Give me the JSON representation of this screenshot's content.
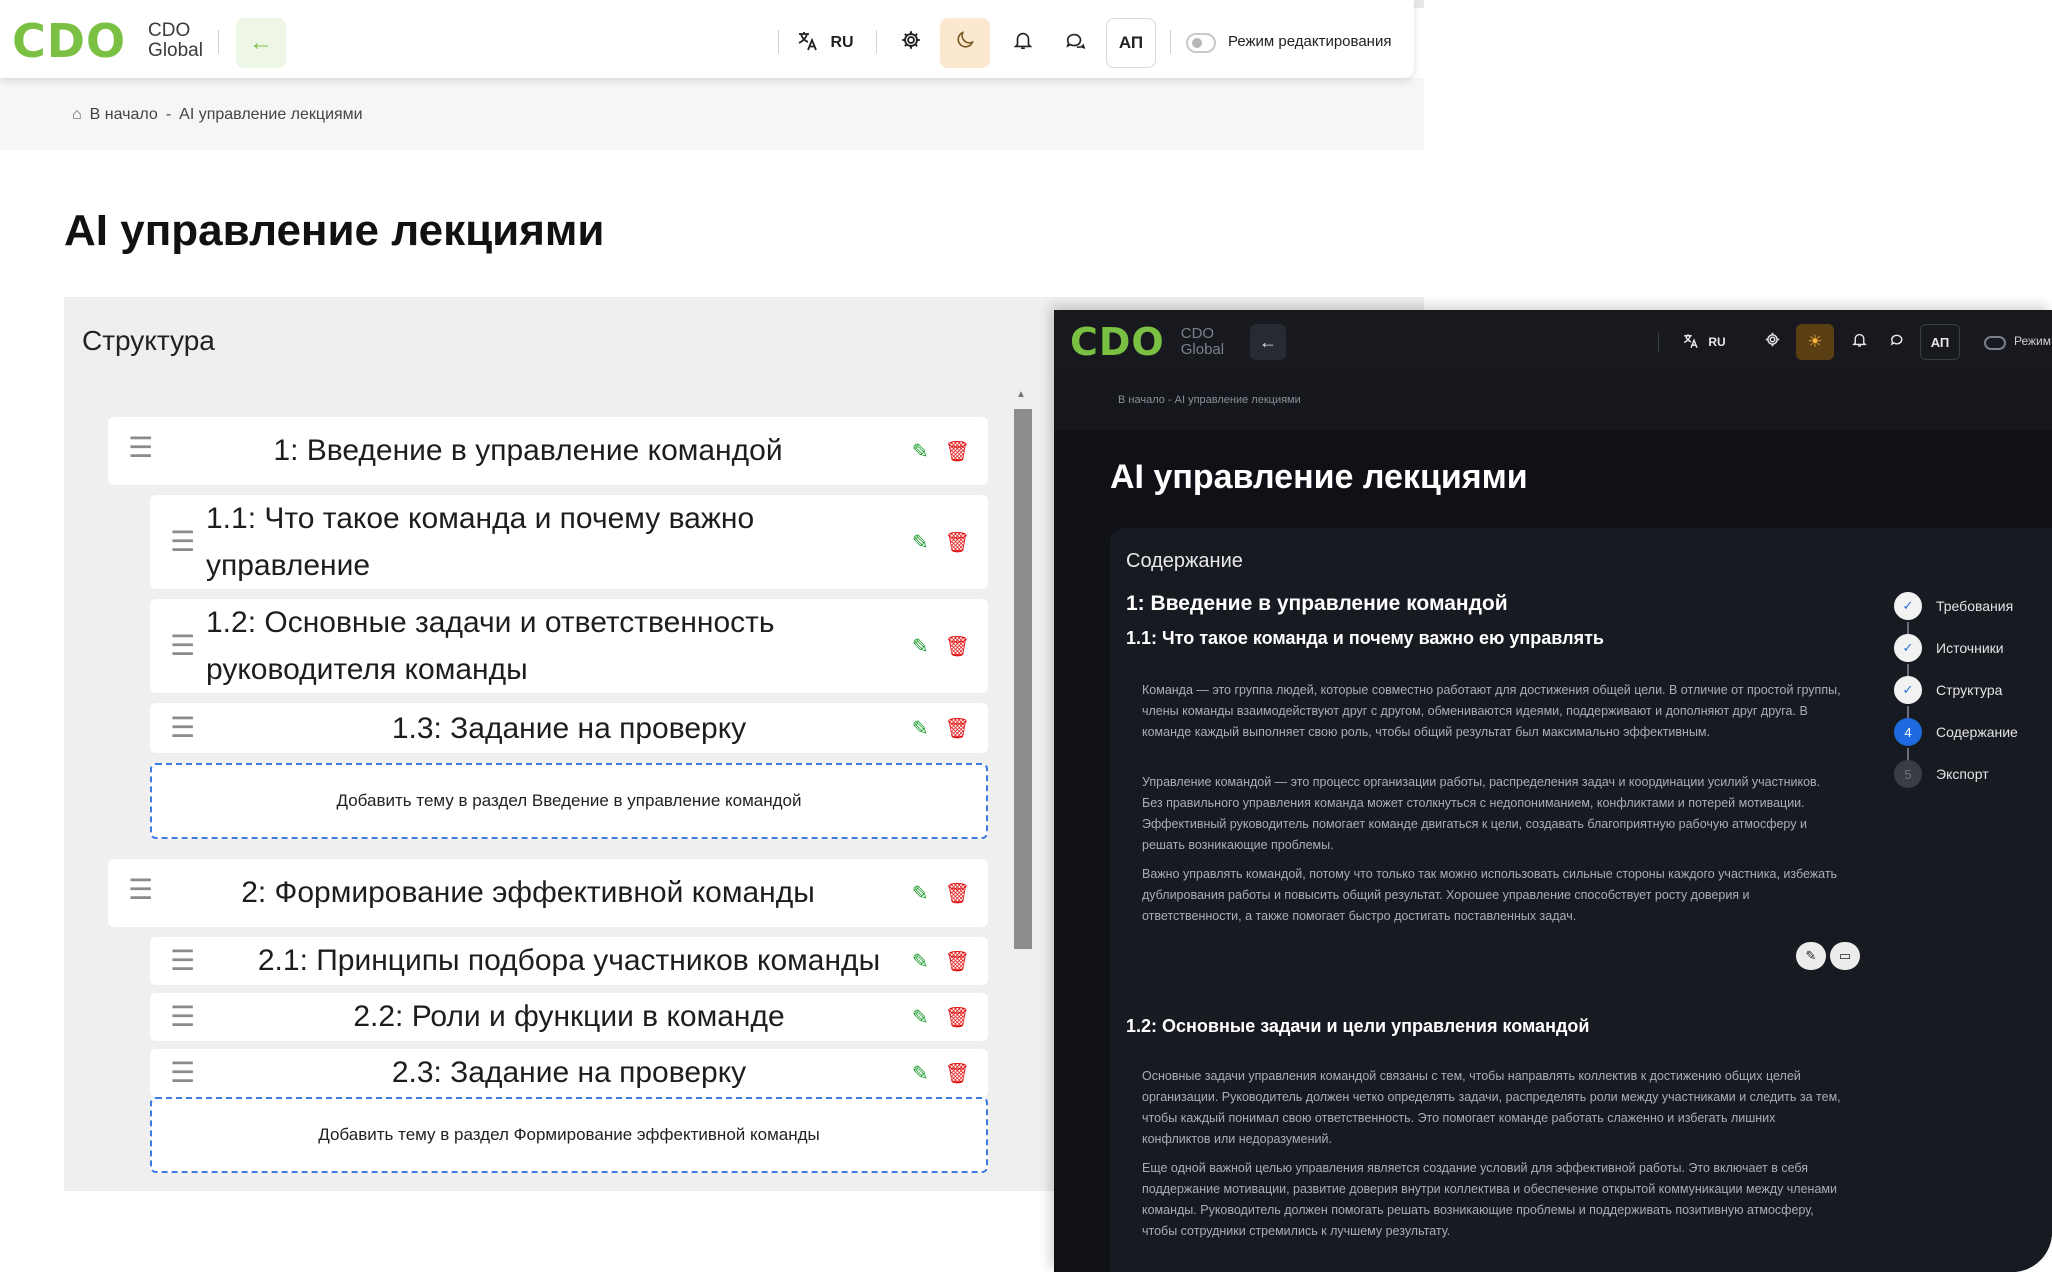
{
  "brand": {
    "mark": "CDO",
    "sub_line1": "CDO",
    "sub_line2": "Global",
    "accent": "#7ac143"
  },
  "header": {
    "back_icon": "arrow-left-icon",
    "language": "RU",
    "avatar_initials": "АП",
    "edit_mode_label": "Режим редактирования",
    "icons": [
      "translate-icon",
      "gear-icon",
      "moon-icon",
      "bell-icon",
      "chat-icon"
    ]
  },
  "breadcrumb": {
    "home": "В начало",
    "separator": "-",
    "current": "AI управление лекциями"
  },
  "page": {
    "title": "AI управление лекциями"
  },
  "structure": {
    "title": "Структура",
    "sections": [
      {
        "label": "1: Введение в управление командой",
        "topics": [
          {
            "label_line1": "1.1: Что такое команда и почему важно",
            "label_line2": "управление"
          },
          {
            "label_line1": "1.2: Основные задачи и ответственность",
            "label_line2": "руководителя команды"
          },
          {
            "label_line1": "1.3: Задание на проверку",
            "label_line2": ""
          }
        ],
        "add_label": "Добавить тему в раздел Введение в управление командой"
      },
      {
        "label": "2: Формирование эффективной команды",
        "topics": [
          {
            "label_line1": "2.1: Принципы подбора участников команды",
            "label_line2": ""
          },
          {
            "label_line1": "2.2: Роли и функции в команде",
            "label_line2": ""
          },
          {
            "label_line1": "2.3: Задание на проверку",
            "label_line2": ""
          }
        ],
        "add_label": "Добавить тему в раздел Формирование эффективной команды"
      }
    ]
  },
  "dark_view": {
    "breadcrumb": "В начало  -  AI управление лекциями",
    "title": "AI управление лекциями",
    "panel_title": "Содержание",
    "heading_1": "1: Введение в управление командой",
    "heading_1_1": "1.1: Что такое команда и почему важно ею управлять",
    "paragraphs_1_1": [
      "Команда — это группа людей, которые совместно работают для достижения общей цели. В отличие от простой группы, члены команды взаимодействуют друг с другом, обмениваются идеями, поддерживают и дополняют друг друга. В команде каждый выполняет свою роль, чтобы общий результат был максимально эффективным.",
      "Управление командой — это процесс организации работы, распределения задач и координации усилий участников. Без правильного управления команда может столкнуться с недопониманием, конфликтами и потерей мотивации. Эффективный руководитель помогает команде двигаться к цели, создавать благоприятную рабочую атмосферу и решать возникающие проблемы.",
      "Важно управлять командой, потому что только так можно использовать сильные стороны каждого участника, избежать дублирования работы и повысить общий результат. Хорошее управление способствует росту доверия и ответственности, а также помогает быстро достигать поставленных задач."
    ],
    "heading_1_2": "1.2: Основные задачи и цели управления командой",
    "paragraphs_1_2": [
      "Основные задачи управления командой связаны с тем, чтобы направлять коллектив к достижению общих целей организации. Руководитель должен четко определять задачи, распределять роли между участниками и следить за тем, чтобы каждый понимал свою ответственность. Это помогает команде работать слаженно и избегать лишних конфликтов или недоразумений.",
      "Еще одной важной целью управления является создание условий для эффективной работы. Это включает в себя поддержание мотивации, развитие доверия внутри коллектива и обеспечение открытой коммуникации между членами команды. Руководитель должен помогать решать возникающие проблемы и поддерживать позитивную атмосферу, чтобы сотрудники стремились к лучшему результату."
    ],
    "steps": [
      {
        "num": "✓",
        "label": "Требования",
        "state": "done"
      },
      {
        "num": "✓",
        "label": "Источники",
        "state": "done"
      },
      {
        "num": "✓",
        "label": "Структура",
        "state": "done"
      },
      {
        "num": "4",
        "label": "Содержание",
        "state": "active"
      },
      {
        "num": "5",
        "label": "Экспорт",
        "state": "todo"
      }
    ]
  }
}
